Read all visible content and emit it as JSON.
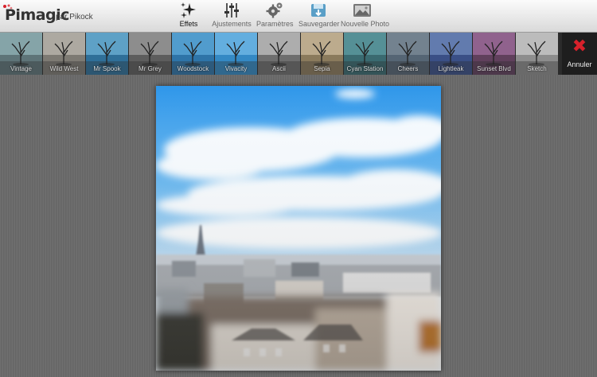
{
  "app": {
    "name": "Pimagic",
    "byline": "par Pikock"
  },
  "toolbar": {
    "tools": [
      {
        "label": "Effets",
        "icon": "sparkles-icon",
        "active": true
      },
      {
        "label": "Ajustements",
        "icon": "sliders-icon",
        "active": false
      },
      {
        "label": "Paramètres",
        "icon": "gears-icon",
        "active": false
      },
      {
        "label": "Sauvegarder",
        "icon": "save-icon",
        "active": false
      },
      {
        "label": "Nouvelle Photo",
        "icon": "photo-icon",
        "active": false
      }
    ]
  },
  "filters": [
    {
      "label": "Vintage"
    },
    {
      "label": "Wild West"
    },
    {
      "label": "Mr Spook"
    },
    {
      "label": "Mr Grey"
    },
    {
      "label": "Woodstock"
    },
    {
      "label": "Vivacity"
    },
    {
      "label": "Ascii"
    },
    {
      "label": "Sepia"
    },
    {
      "label": "Cyan Station"
    },
    {
      "label": "Cheers"
    },
    {
      "label": "Lightleak"
    },
    {
      "label": "Sunset Blvd"
    },
    {
      "label": "Sketch"
    }
  ],
  "cancel": {
    "label": "Annuler"
  },
  "colors": {
    "accent_red": "#d8212b",
    "sky_blue": "#3a9fe8"
  }
}
